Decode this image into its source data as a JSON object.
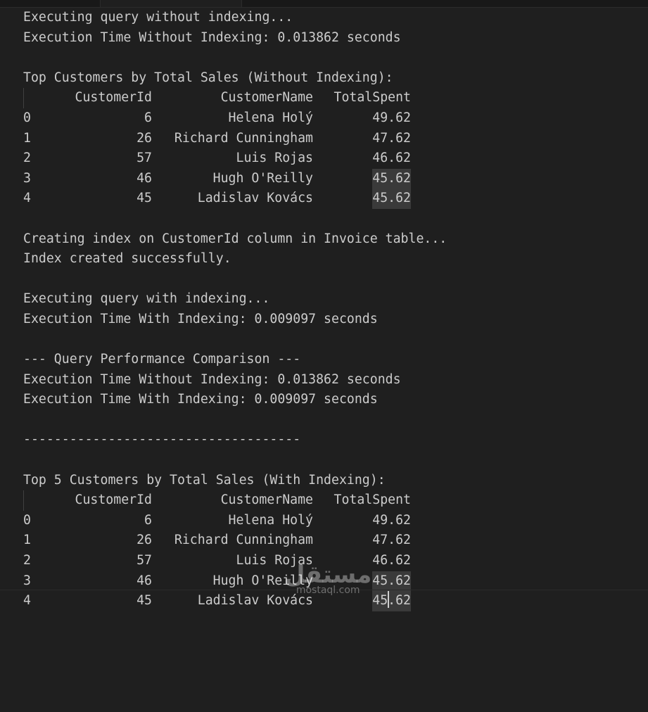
{
  "output": {
    "run1_title": "Executing query without indexing...",
    "run1_time": "Execution Time Without Indexing: 0.013862 seconds",
    "table1_title": "Top Customers by Total Sales (Without Indexing):",
    "index_msg": "Creating index on CustomerId column in Invoice table...",
    "index_ok": "Index created successfully.",
    "run2_title": "Executing query with indexing...",
    "run2_time": "Execution Time With Indexing: 0.009097 seconds",
    "comparison_title": "--- Query Performance Comparison ---",
    "comparison_without": "Execution Time Without Indexing: 0.013862 seconds",
    "comparison_with": "Execution Time With Indexing: 0.009097 seconds",
    "separator": "------------------------------------",
    "table2_title": "Top 5 Customers by Total Sales (With Indexing):"
  },
  "table": {
    "headers": [
      "CustomerId",
      "CustomerName",
      "TotalSpent"
    ],
    "rows1": [
      {
        "idx": "0",
        "id": "6",
        "name": "Helena Holý",
        "spent": "49.62"
      },
      {
        "idx": "1",
        "id": "26",
        "name": "Richard Cunningham",
        "spent": "47.62"
      },
      {
        "idx": "2",
        "id": "57",
        "name": "Luis Rojas",
        "spent": "46.62"
      },
      {
        "idx": "3",
        "id": "46",
        "name": "Hugh O'Reilly",
        "spent": "45.62"
      },
      {
        "idx": "4",
        "id": "45",
        "name": "Ladislav Kovács",
        "spent": "45.62"
      }
    ],
    "rows2": [
      {
        "idx": "0",
        "id": "6",
        "name": "Helena Holý",
        "spent": "49.62"
      },
      {
        "idx": "1",
        "id": "26",
        "name": "Richard Cunningham",
        "spent": "47.62"
      },
      {
        "idx": "2",
        "id": "57",
        "name": "Luis Rojas",
        "spent": "46.62"
      },
      {
        "idx": "3",
        "id": "46",
        "name": "Hugh O'Reilly",
        "spent": "45.62"
      },
      {
        "idx": "4",
        "id": "45",
        "name": "Ladislav Kovács",
        "spent": "45.62"
      }
    ]
  },
  "watermark": {
    "arabic": "مستقل",
    "latin": "mostaql.com"
  },
  "colors": {
    "background": "#1f1f1f",
    "text": "#cccccc",
    "selection": "#3a3a3a"
  }
}
